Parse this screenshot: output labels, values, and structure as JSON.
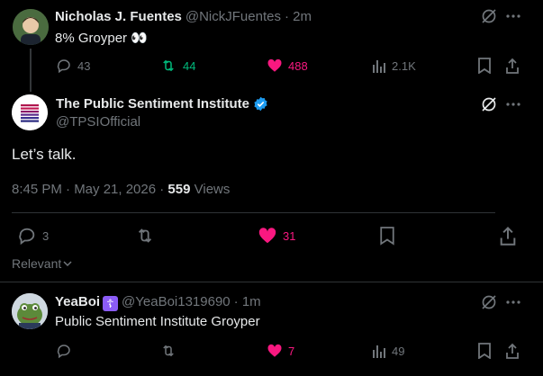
{
  "colors": {
    "background": "#000000",
    "text": "#e7e9ea",
    "muted": "#71767b",
    "like": "#f91880",
    "retweet_green": "#00ba7c",
    "verified_blue": "#1d9bf0"
  },
  "tweet1": {
    "name": "Nicholas J. Fuentes",
    "handle": "@NickJFuentes",
    "time": "· 2m",
    "text": "8% Groyper 👀",
    "replies": "43",
    "retweets": "44",
    "likes": "488",
    "views": "2.1K"
  },
  "main_tweet": {
    "name": "The Public Sentiment Institute",
    "handle": "@TPSIOfficial",
    "text": "Let’s talk.",
    "timestamp": "8:45 PM · May 21, 2026 ·",
    "views_count": "559",
    "views_label": "Views",
    "replies": "3",
    "retweets": "",
    "likes": "31"
  },
  "sort": {
    "label": "Relevant"
  },
  "reply1": {
    "name": "YeaBoi",
    "badge": "☦",
    "handle": "@YeaBoi1319690",
    "time": "· 1m",
    "text": "Public Sentiment Institute Groyper",
    "replies": "",
    "retweets": "",
    "likes": "7",
    "views": "49"
  },
  "icons": [
    "grok-icon",
    "more-icon",
    "reply-icon",
    "retweet-icon",
    "like-icon",
    "views-icon",
    "bookmark-icon",
    "share-icon",
    "verified-icon"
  ]
}
